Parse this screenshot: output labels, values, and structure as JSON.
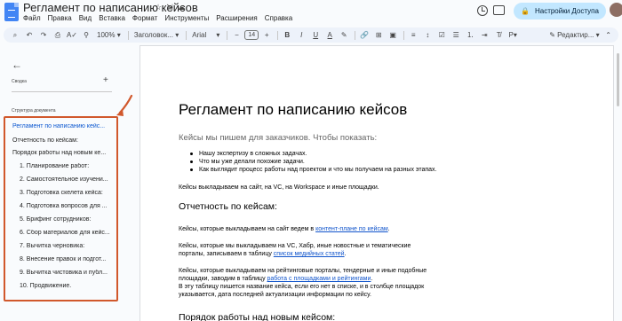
{
  "document": {
    "title": "Регламент по написанию кейсов"
  },
  "title_icons": [
    "star-icon",
    "move-icon",
    "cloud-icon"
  ],
  "menu": [
    "Файл",
    "Правка",
    "Вид",
    "Вставка",
    "Формат",
    "Инструменты",
    "Расширения",
    "Справка"
  ],
  "header": {
    "share_label": "Настройки Доступа"
  },
  "toolbar": {
    "zoom": "100%",
    "style": "Заголовок...",
    "font": "Arial",
    "size_minus": "−",
    "size": "14",
    "size_plus": "+",
    "bold": "B",
    "italic": "I",
    "underline": "U",
    "text_color": "A",
    "mode": "Редактир..."
  },
  "panel": {
    "back_glyph": "←",
    "summary_label": "Сводка",
    "summary_add": "+",
    "outline_label": "Структура документа",
    "items": [
      "Регламент по написанию кейс...",
      "Отчетность по кейсам:",
      "Порядок работы над новым ке...",
      "1. Планирование работ:",
      "2. Самостоятельное изучени...",
      "3. Подготовка скелета кейса:",
      "4. Подготовка вопросов для ...",
      "5. Брифинг сотрудников:",
      "6. Сбор материалов для кейс...",
      "7. Вычитка черновика:",
      "8. Внесение правок и подгот...",
      "9. Вычитка чистовика и публ...",
      "10. Продвижение."
    ]
  },
  "content": {
    "heading": "Регламент по написанию кейсов",
    "subtitle": "Кейсы мы пишем для заказчиков. Чтобы показать:",
    "bullets": [
      "Нашу экспертизу в сложных задачах.",
      "Что мы уже делали похожие задачи.",
      "Как выглядит процесс работы над проектом и что мы получаем на разных этапах."
    ],
    "para_publish": "Кейсы выкладываем на сайт, на VC, на Workspace  и иные площадки.",
    "section_heading": "Отчетность по кейсам:",
    "para_site_prefix": "Кейсы, которые выкладываем на сайт ведем в ",
    "para_site_link": "контент-плане по кейсам",
    "para_site_suffix": ".",
    "para_vc_prefix": "Кейсы, которые мы выкладываем на VC, Хабр, иные новостные и тематические порталы, записываем в таблицу ",
    "para_vc_link": "список медийных статей",
    "para_vc_suffix": ".",
    "para_rating_prefix": "Кейсы, которые выкладываем на рейтинговые порталы, тендерные и иные подобные площадки, заводим в таблицу ",
    "para_rating_link": "работа с площадками и рейтингами",
    "para_rating_suffix": ".",
    "para_rating_extra": "В эту таблицу пишется название кейса, если его нет в списке, и в столбце площадок указывается, дата последней актуализации информации по кейсу.",
    "next_heading": "Порядок работы над новым кейсом:"
  },
  "colors": {
    "accent": "#0b57d0",
    "share_bg": "#c2e7ff",
    "highlight_box": "#d1582c",
    "link": "#1155cc"
  }
}
